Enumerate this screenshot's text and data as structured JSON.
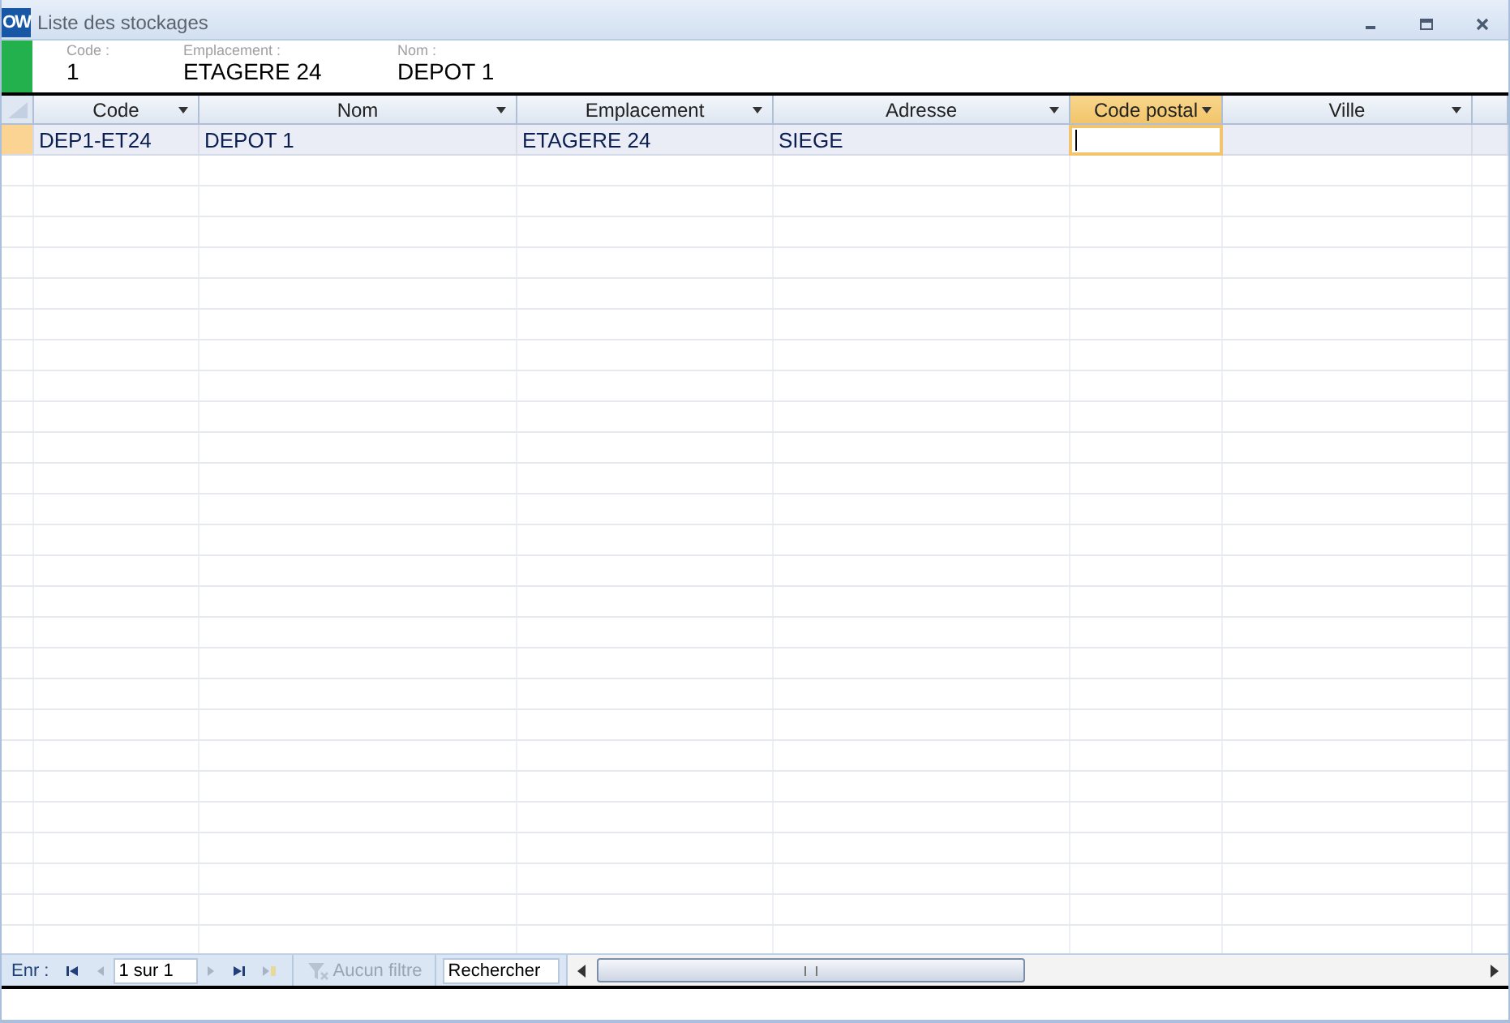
{
  "window": {
    "icon": "OW",
    "title": "Liste des stockages"
  },
  "header_fields": [
    {
      "label": "Code :",
      "value": "1"
    },
    {
      "label": "Emplacement :",
      "value": "ETAGERE 24"
    },
    {
      "label": "Nom :",
      "value": "DEPOT 1"
    }
  ],
  "table": {
    "columns": [
      {
        "label": "Code",
        "selected": false
      },
      {
        "label": "Nom",
        "selected": false
      },
      {
        "label": "Emplacement",
        "selected": false
      },
      {
        "label": "Adresse",
        "selected": false
      },
      {
        "label": "Code postal",
        "selected": true
      },
      {
        "label": "Ville",
        "selected": false
      }
    ],
    "rows": [
      {
        "selected": true,
        "cells": [
          "DEP1-ET24",
          "DEPOT 1",
          "ETAGERE 24",
          "SIEGE",
          "",
          ""
        ]
      }
    ]
  },
  "navigator": {
    "label": "Enr :",
    "position": "1 sur 1",
    "filter": {
      "label": "Aucun filtre",
      "disabled": true
    },
    "search": {
      "placeholder": "Rechercher"
    }
  }
}
